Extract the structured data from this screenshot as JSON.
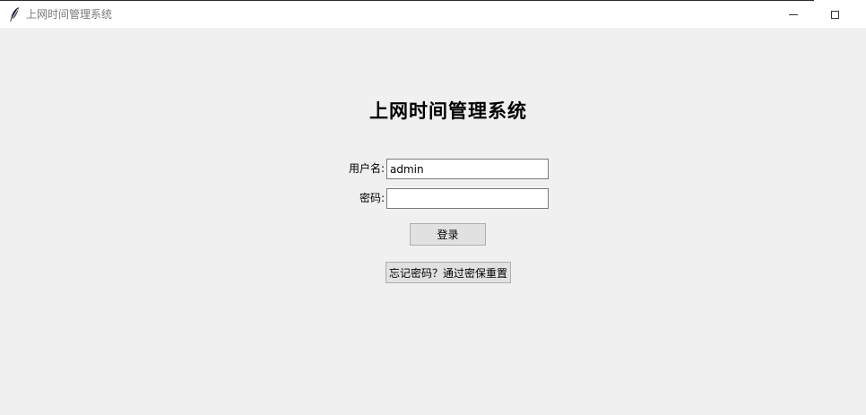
{
  "window": {
    "title": "上网时间管理系统",
    "icon": "feather-icon",
    "controls": {
      "minimize": "minimize-icon",
      "maximize": "maximize-icon"
    }
  },
  "form": {
    "heading": "上网时间管理系统",
    "username_label": "用户名:",
    "username_value": "admin",
    "password_label": "密码:",
    "password_value": "",
    "login_button": "登录",
    "forgot_button": "忘记密码？通过密保重置"
  }
}
